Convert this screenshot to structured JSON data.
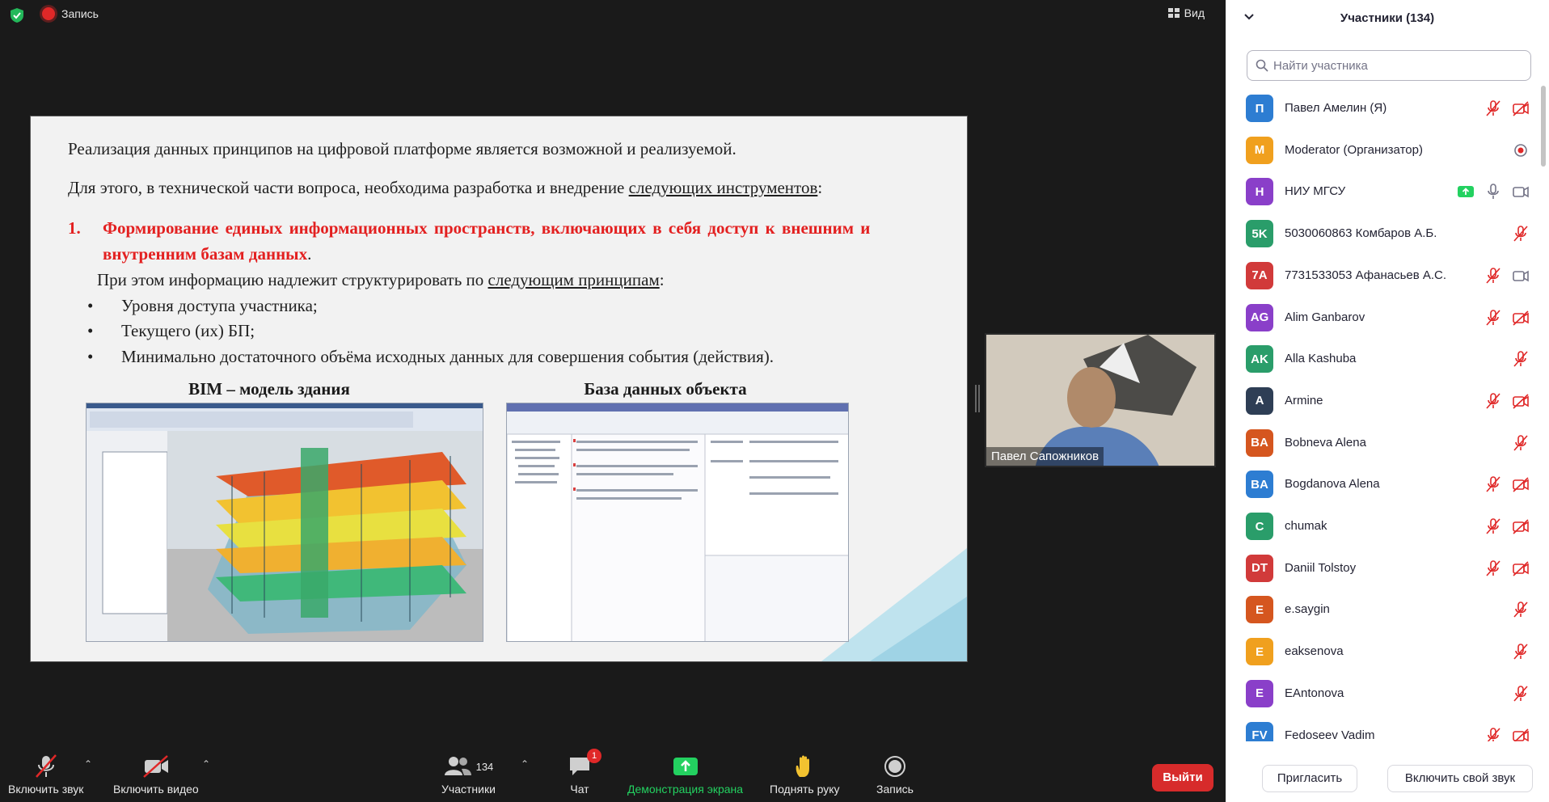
{
  "topbar": {
    "record_label": "Запись",
    "view_label": "Вид"
  },
  "slide": {
    "line1": "Реализация данных принципов на цифровой платформе является возможной и реализуемой.",
    "line2_pre": "Для этого, в технической части вопроса, необходима разработка и внедрение ",
    "line2_ul": "следующих инструментов",
    "line2_post": ":",
    "item1_num": "1.",
    "item1_red_a": "Формирование единых информационных пространств, включающих в себя доступ к внешним и",
    "item1_red_b": "внутренним базам данных",
    "item1_end": ".",
    "line4_pre": "При этом информацию надлежит структурировать по ",
    "line4_ul": "следующим принципам",
    "line4_post": ":",
    "bullets": [
      "Уровня доступа участника;",
      "Текущего (их) БП;",
      "Минимально достаточного объёма исходных данных для совершения события (действия)."
    ],
    "caption_left": "BIM – модель здания",
    "caption_right": "База данных объекта"
  },
  "video": {
    "name": "Павел Сапожников"
  },
  "toolbar": {
    "mute_label": "Включить звук",
    "video_label": "Включить видео",
    "participants_label": "Участники",
    "participants_count": "134",
    "chat_label": "Чат",
    "chat_badge": "1",
    "share_label": "Демонстрация экрана",
    "raise_hand_label": "Поднять руку",
    "record_label": "Запись",
    "leave_label": "Выйти"
  },
  "panel": {
    "title": "Участники (134)",
    "search_placeholder": "Найти участника",
    "invite_label": "Пригласить",
    "unmute_label": "Включить свой звук",
    "participants": [
      {
        "initials": "П",
        "name": "Павел Амелин (Я)",
        "color": "#2d7dd2",
        "icons": [
          "mic-muted",
          "video-off"
        ]
      },
      {
        "initials": "M",
        "name": "Moderator (Организатор)",
        "color": "#f0a01e",
        "icons": [
          "recording"
        ]
      },
      {
        "initials": "Н",
        "name": "НИУ МГСУ",
        "color": "#8a3fc9",
        "icons": [
          "share",
          "mic",
          "video"
        ]
      },
      {
        "initials": "5K",
        "name": "5030060863 Комбаров А.Б.",
        "color": "#2a9d6a",
        "icons": [
          "mic-muted"
        ]
      },
      {
        "initials": "7A",
        "name": "7731533053 Афанасьев А.С.",
        "color": "#d13a3a",
        "icons": [
          "mic-muted",
          "video"
        ]
      },
      {
        "initials": "AG",
        "name": "Alim Ganbarov",
        "color": "#8a3fc9",
        "icons": [
          "mic-muted",
          "video-off"
        ]
      },
      {
        "initials": "AK",
        "name": "Alla Kashuba",
        "color": "#2a9d6a",
        "icons": [
          "mic-muted"
        ]
      },
      {
        "initials": "A",
        "name": "Armine",
        "color": "#2e3e55",
        "icons": [
          "mic-muted",
          "video-off"
        ]
      },
      {
        "initials": "BA",
        "name": "Bobneva Alena",
        "color": "#d5561f",
        "icons": [
          "mic-muted"
        ]
      },
      {
        "initials": "BA",
        "name": "Bogdanova Alena",
        "color": "#2d7dd2",
        "icons": [
          "mic-muted",
          "video-off"
        ]
      },
      {
        "initials": "C",
        "name": "chumak",
        "color": "#2a9d6a",
        "icons": [
          "mic-muted",
          "video-off"
        ]
      },
      {
        "initials": "DT",
        "name": "Daniil Tolstoy",
        "color": "#d13a3a",
        "icons": [
          "mic-muted",
          "video-off"
        ]
      },
      {
        "initials": "E",
        "name": "e.saygin",
        "color": "#d5561f",
        "icons": [
          "mic-muted"
        ]
      },
      {
        "initials": "E",
        "name": "eaksenova",
        "color": "#f0a01e",
        "icons": [
          "mic-muted"
        ]
      },
      {
        "initials": "E",
        "name": "EAntonova",
        "color": "#8a3fc9",
        "icons": [
          "mic-muted"
        ]
      },
      {
        "initials": "FV",
        "name": "Fedoseev Vadim",
        "color": "#2d7dd2",
        "icons": [
          "mic-muted",
          "video-off"
        ]
      }
    ]
  },
  "colors": {
    "muted_icon": "#e02828",
    "share_green": "#23d160",
    "leave_red": "#d72b2b"
  }
}
